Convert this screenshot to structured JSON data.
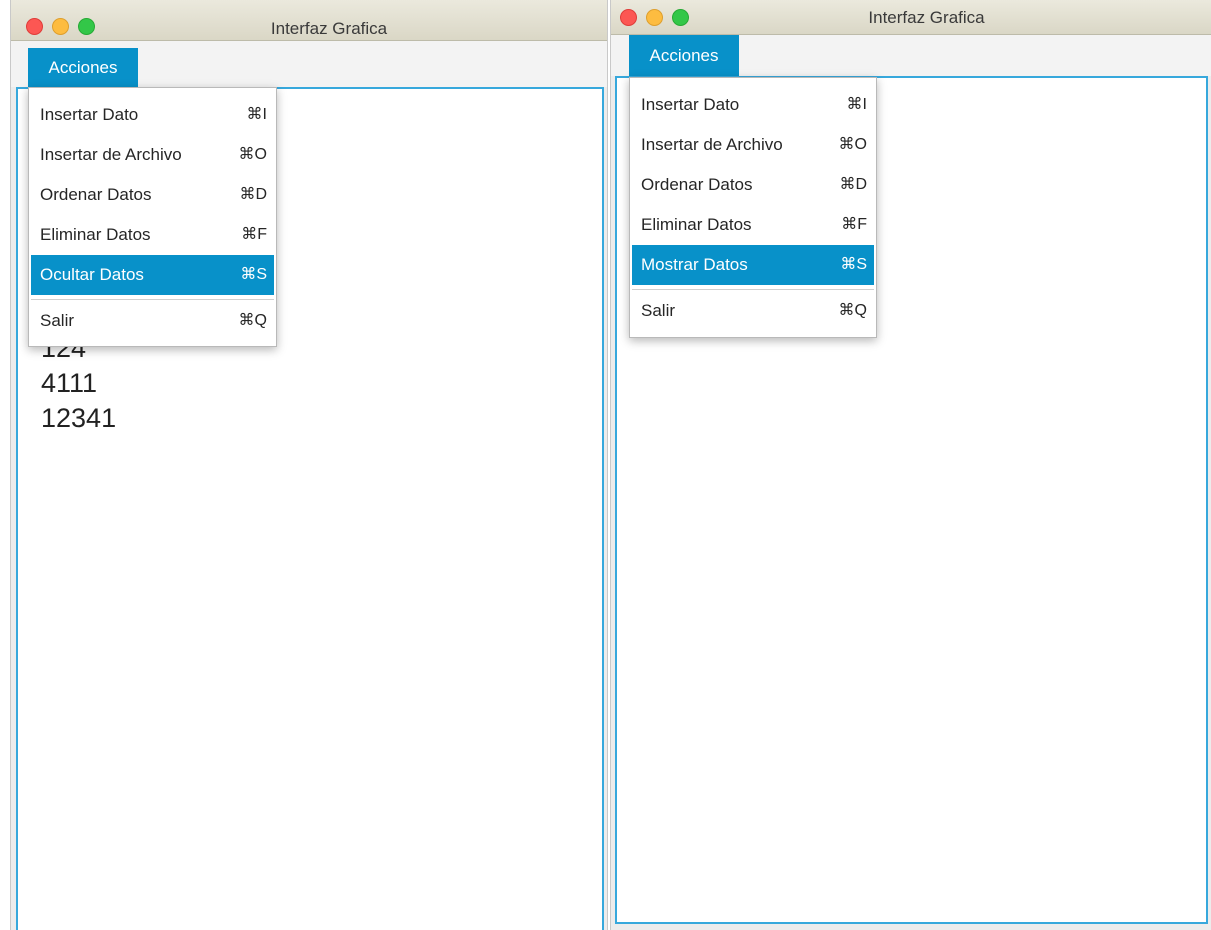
{
  "left_window": {
    "title": "Interfaz Grafica",
    "menu_title": "Acciones",
    "menu_items": [
      {
        "label": "Insertar Dato",
        "shortcut": "⌘I"
      },
      {
        "label": "Insertar de Archivo",
        "shortcut": "⌘O"
      },
      {
        "label": "Ordenar Datos",
        "shortcut": "⌘D"
      },
      {
        "label": "Eliminar Datos",
        "shortcut": "⌘F"
      },
      {
        "label": "Ocultar Datos",
        "shortcut": "⌘S",
        "highlighted": true
      },
      {
        "label": "Salir",
        "shortcut": "⌘Q"
      }
    ],
    "data_values": [
      "124",
      "4111",
      "12341"
    ]
  },
  "right_window": {
    "title": "Interfaz Grafica",
    "menu_title": "Acciones",
    "menu_items": [
      {
        "label": "Insertar Dato",
        "shortcut": "⌘I"
      },
      {
        "label": "Insertar de Archivo",
        "shortcut": "⌘O"
      },
      {
        "label": "Ordenar Datos",
        "shortcut": "⌘D"
      },
      {
        "label": "Eliminar Datos",
        "shortcut": "⌘F"
      },
      {
        "label": "Mostrar Datos",
        "shortcut": "⌘S",
        "highlighted": true
      },
      {
        "label": "Salir",
        "shortcut": "⌘Q"
      }
    ]
  },
  "colors": {
    "accent": "#0891c9",
    "content_border": "#37a8dc",
    "close": "#fc5753",
    "minimize": "#fdbc40",
    "maximize": "#33c748"
  }
}
